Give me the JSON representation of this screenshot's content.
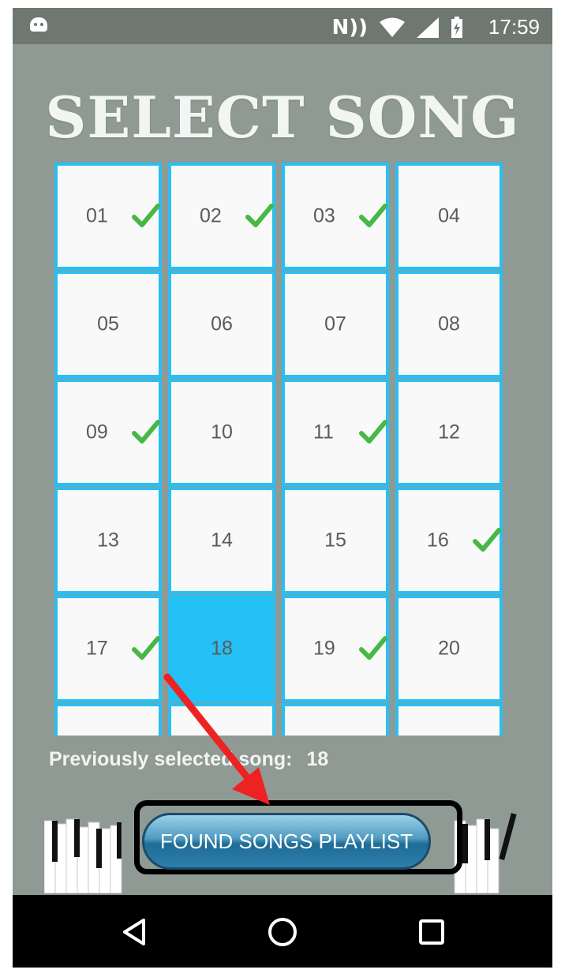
{
  "status_bar": {
    "time": "17:59",
    "nfc": "N))"
  },
  "title": "SELECT SONG",
  "songs": [
    {
      "label": "01",
      "checked": true
    },
    {
      "label": "02",
      "checked": true
    },
    {
      "label": "03",
      "checked": true
    },
    {
      "label": "04",
      "checked": false
    },
    {
      "label": "05",
      "checked": false
    },
    {
      "label": "06",
      "checked": false
    },
    {
      "label": "07",
      "checked": false
    },
    {
      "label": "08",
      "checked": false
    },
    {
      "label": "09",
      "checked": true
    },
    {
      "label": "10",
      "checked": false
    },
    {
      "label": "11",
      "checked": true
    },
    {
      "label": "12",
      "checked": false
    },
    {
      "label": "13",
      "checked": false
    },
    {
      "label": "14",
      "checked": false
    },
    {
      "label": "15",
      "checked": false
    },
    {
      "label": "16",
      "checked": true
    },
    {
      "label": "17",
      "checked": true
    },
    {
      "label": "18",
      "checked": false,
      "selected": true
    },
    {
      "label": "19",
      "checked": true
    },
    {
      "label": "20",
      "checked": false
    },
    {
      "label": "",
      "checked": false
    },
    {
      "label": "",
      "checked": false
    },
    {
      "label": "",
      "checked": false
    },
    {
      "label": "",
      "checked": false
    }
  ],
  "previous": {
    "label": "Previously selected song:",
    "value": "18"
  },
  "playlist_button": "FOUND SONGS PLAYLIST",
  "colors": {
    "cell_border": "#28bff2",
    "selected": "#23c1f6",
    "check": "#45b845",
    "annotation_arrow": "#ee2222"
  },
  "nav": [
    "back-icon",
    "home-icon",
    "recents-icon"
  ]
}
